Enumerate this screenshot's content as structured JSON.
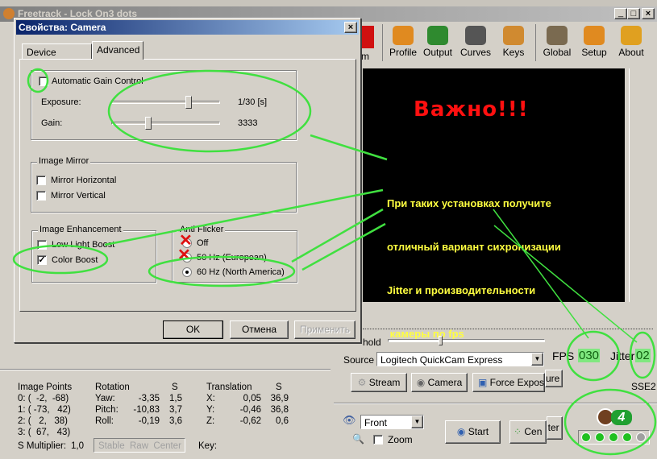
{
  "main_window": {
    "title": "Freetrack - Lock On3 dots",
    "controls": [
      "minimize",
      "maximize",
      "close"
    ]
  },
  "toolbar": {
    "partial_button": "m",
    "buttons": [
      {
        "label": "Profile",
        "icon": "head-profile-icon",
        "color": "#e08a20"
      },
      {
        "label": "Output",
        "icon": "puzzle-output-icon",
        "color": "#2f8a2f"
      },
      {
        "label": "Curves",
        "icon": "curves-icon",
        "color": "#555555"
      },
      {
        "label": "Keys",
        "icon": "keys-icon",
        "color": "#d08a30"
      },
      {
        "label": "Global",
        "icon": "sliders-icon",
        "color": "#7a6a50"
      },
      {
        "label": "Setup",
        "icon": "head-setup-icon",
        "color": "#e08a20"
      },
      {
        "label": "About",
        "icon": "head-about-icon",
        "color": "#e0a020"
      }
    ]
  },
  "video": {
    "headline": "Важно!!!",
    "note_lines": [
      "При таких установках получите",
      "отличный вариант сихронизации",
      "Jitter и производительности",
      " камеры по fps"
    ],
    "headline_color": "#ff1010",
    "note_color": "#ffff40"
  },
  "dialog": {
    "title": "Свойства: Camera",
    "tabs": [
      "Device Settings",
      "Advanced"
    ],
    "active_tab": "Advanced",
    "agc": {
      "label": "Automatic Gain Control",
      "checked": false
    },
    "exposure": {
      "label": "Exposure:",
      "value": "1/30 [s]",
      "slider_fraction": 0.71
    },
    "gain": {
      "label": "Gain:",
      "value": "3333",
      "slider_fraction": 0.34
    },
    "image_mirror": {
      "title": "Image Mirror",
      "items": [
        {
          "label": "Mirror Horizontal",
          "checked": false
        },
        {
          "label": "Mirror Vertical",
          "checked": false
        }
      ]
    },
    "image_enhancement": {
      "title": "Image Enhancement",
      "items": [
        {
          "label": "Low Light Boost",
          "checked": false
        },
        {
          "label": "Color Boost",
          "checked": true
        }
      ]
    },
    "anti_flicker": {
      "title": "Anti Flicker",
      "options": [
        "Off",
        "50 Hz (European)",
        "60 Hz (North America)"
      ],
      "selected": "60 Hz (North America)"
    },
    "buttons": {
      "ok": "OK",
      "cancel": "Отмена",
      "apply": "Применить"
    }
  },
  "camera_panel": {
    "threshold_label": "hold",
    "source_label": "Source",
    "source_value": "Logitech QuickCam Express",
    "fps_label": "FPS",
    "fps_value": "030",
    "jitter_label": "Jitter",
    "jitter_value": "02",
    "sse": "SSE2",
    "buttons": {
      "stream": "Stream",
      "camera": "Camera",
      "force_exposure": "Force Exposu",
      "force_exposure_tail": "ure"
    }
  },
  "stats": {
    "image_points_title": "Image Points",
    "points": [
      "0: (  -2,  -68)",
      "1: ( -73,   42)",
      "2: (   2,   38)",
      "3: (  67,   43)"
    ],
    "rotation_title": "Rotation",
    "s_title": "S",
    "rotation": [
      {
        "axis": "Yaw:",
        "value": "-3,35",
        "s": "1,5"
      },
      {
        "axis": "Pitch:",
        "value": "-10,83",
        "s": "3,7"
      },
      {
        "axis": "Roll:",
        "value": "-0,19",
        "s": "3,6"
      }
    ],
    "translation_title": "Translation",
    "translation": [
      {
        "axis": "X:",
        "value": "0,05",
        "s": "36,9"
      },
      {
        "axis": "Y:",
        "value": "-0,46",
        "s": "36,8"
      },
      {
        "axis": "Z:",
        "value": "-0,62",
        "s": "0,6"
      }
    ],
    "s_multiplier_label": "S Multiplier:",
    "s_multiplier": "1,0",
    "stable_raw_center": "Stable  Raw  Center",
    "key_label": "Key:"
  },
  "controls": {
    "view_value": "Front",
    "zoom_label": "Zoom",
    "zoom_checked": false,
    "start": "Start",
    "center": "Cen",
    "center_tail": "nter",
    "leds": [
      true,
      true,
      true,
      true,
      false
    ],
    "led_on_color": "#20c020",
    "annotation_color": "#40e040"
  }
}
